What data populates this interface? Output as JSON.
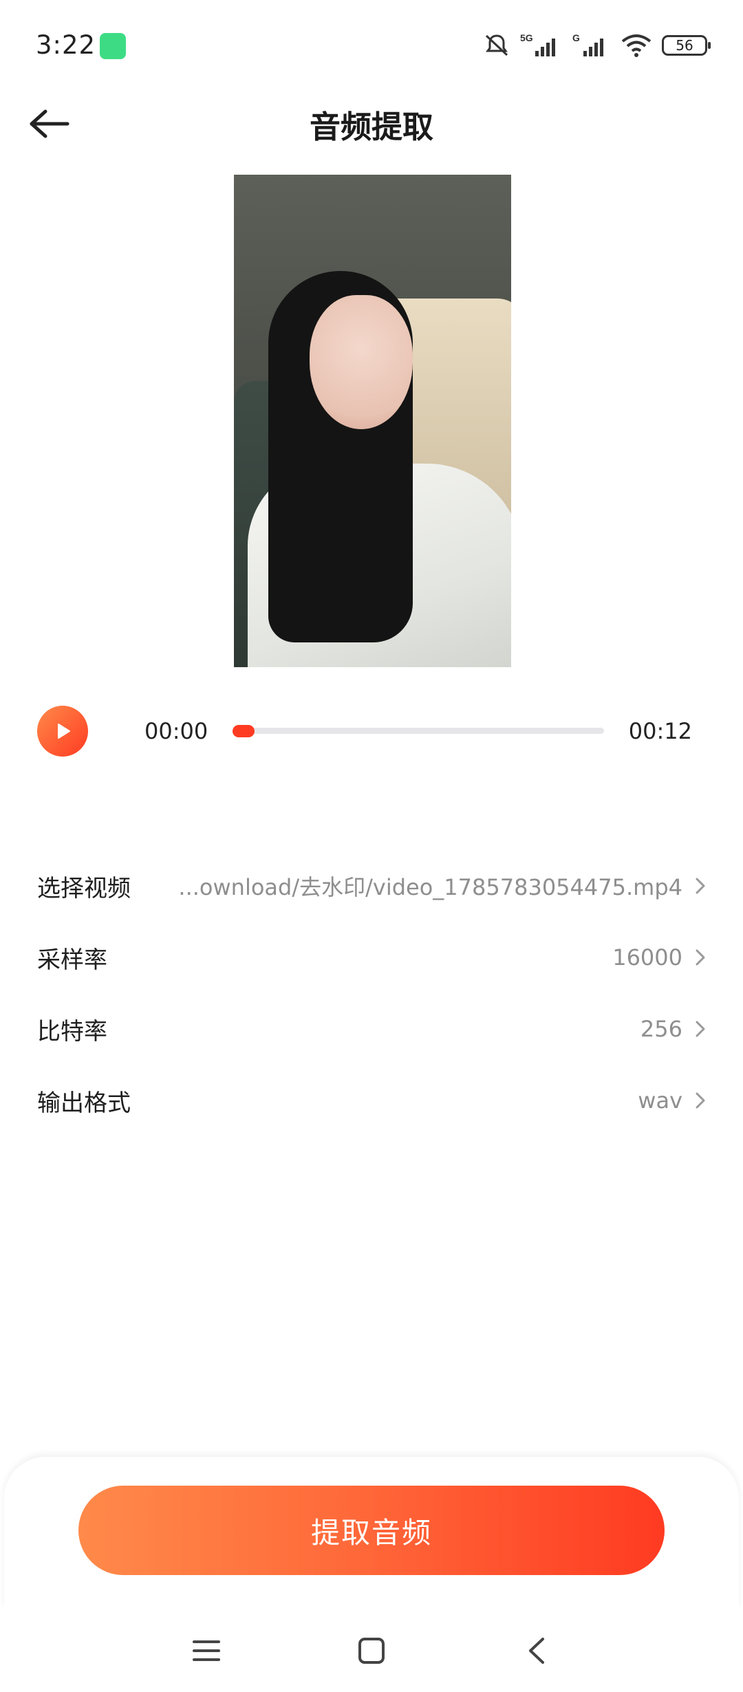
{
  "status_bar": {
    "time": "3:22",
    "battery": "56",
    "icons": [
      "android-icon",
      "silent-bell-icon",
      "5g-signal-icon",
      "g-signal-icon",
      "wifi-icon",
      "battery-icon"
    ]
  },
  "header": {
    "title": "音频提取",
    "back_icon": "back-arrow-icon"
  },
  "player": {
    "current_time": "00:00",
    "total_time": "00:12",
    "progress": 0.06,
    "accent": "#ff3b22"
  },
  "settings": [
    {
      "label": "选择视频",
      "value": "...ownload/去水印/video_1785783054475.mp4"
    },
    {
      "label": "采样率",
      "value": "16000"
    },
    {
      "label": "比特率",
      "value": "256"
    },
    {
      "label": "输出格式",
      "value": "wav"
    }
  ],
  "action": {
    "extract_label": "提取音频"
  },
  "nav": {
    "icons": [
      "menu-icon",
      "home-icon",
      "back-icon"
    ]
  },
  "colors": {
    "gradient_start": "#ff8a4a",
    "gradient_end": "#ff3b22",
    "secondary_text": "#8e8e8e"
  }
}
